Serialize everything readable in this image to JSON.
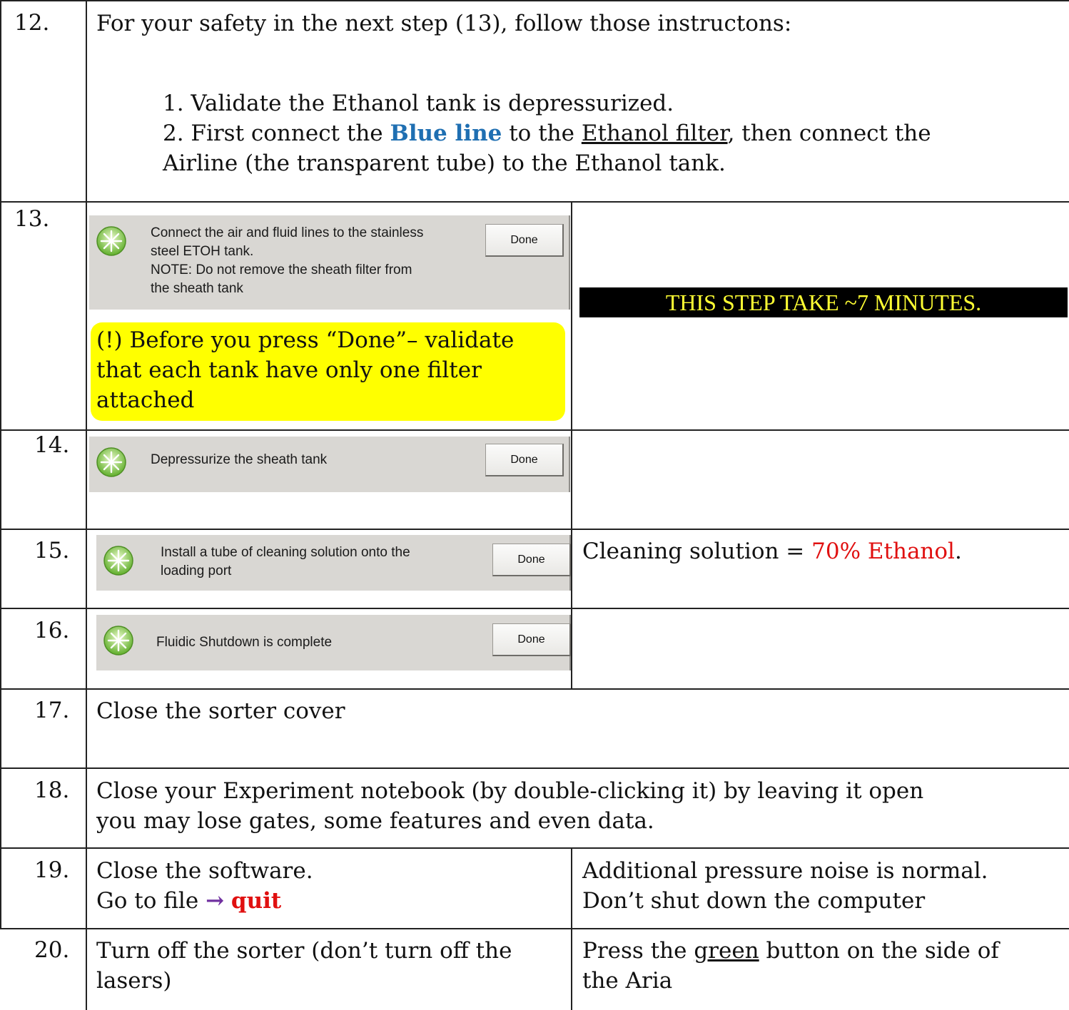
{
  "rows": {
    "r12": {
      "number": "12.",
      "intro": "For your safety in the next step (13), follow those instructons:",
      "item1": "1. Validate the Ethanol tank is depressurized.",
      "item2_a": "2. First connect the ",
      "item2_blue": "Blue line",
      "item2_b": " to the ",
      "item2_underline": "Ethanol filter",
      "item2_c": ", then connect the",
      "item2_line2": "Airline (the transparent tube) to the Ethanol tank."
    },
    "r13": {
      "number": "13.",
      "dialog_line1": "Connect the air and fluid lines to the stainless",
      "dialog_line2": "steel ETOH tank.",
      "dialog_line3": "NOTE: Do not remove the sheath filter from",
      "dialog_line4": "the sheath tank",
      "done": "Done",
      "warning_line1": "(!) Before you press “Done”– validate",
      "warning_line2": "that each tank have only one filter",
      "warning_line3": "attached",
      "banner": "THIS STEP TAKE ~7 MINUTES."
    },
    "r14": {
      "number": "14.",
      "dialog": "Depressurize the sheath tank",
      "done": "Done"
    },
    "r15": {
      "number": "15.",
      "dialog_line1": "Install a tube of cleaning solution onto the",
      "dialog_line2": "loading port",
      "done": "Done",
      "note_a": "Cleaning solution = ",
      "note_red": "70% Ethanol",
      "note_b": "."
    },
    "r16": {
      "number": "16.",
      "dialog": "Fluidic Shutdown is complete",
      "done": "Done"
    },
    "r17": {
      "number": "17.",
      "text": "Close the sorter cover"
    },
    "r18": {
      "number": "18.",
      "line1": "Close your Experiment notebook (by double-clicking it) by leaving it open",
      "line2": "you may lose gates, some features and even data."
    },
    "r19": {
      "number": "19.",
      "line1": "Close the software.",
      "line2_a": "Go to file ",
      "arrow": "→",
      "quit": "quit",
      "note_line1": "Additional pressure noise is normal.",
      "note_line2": "Don’t shut down the computer"
    },
    "r20": {
      "number": "20.",
      "line1": "Turn off the sorter (don’t turn off the",
      "line2": "lasers)",
      "note_a": "Press the ",
      "note_underline": "green",
      "note_b": " button on the side of",
      "note_line2": "the Aria"
    }
  },
  "colors": {
    "blue_line": "#1f6fb2",
    "red": "#e01010",
    "arrow": "#7030a0",
    "warning_bg": "#ffff00",
    "banner_bg": "#000000",
    "banner_text": "#ffff33"
  }
}
